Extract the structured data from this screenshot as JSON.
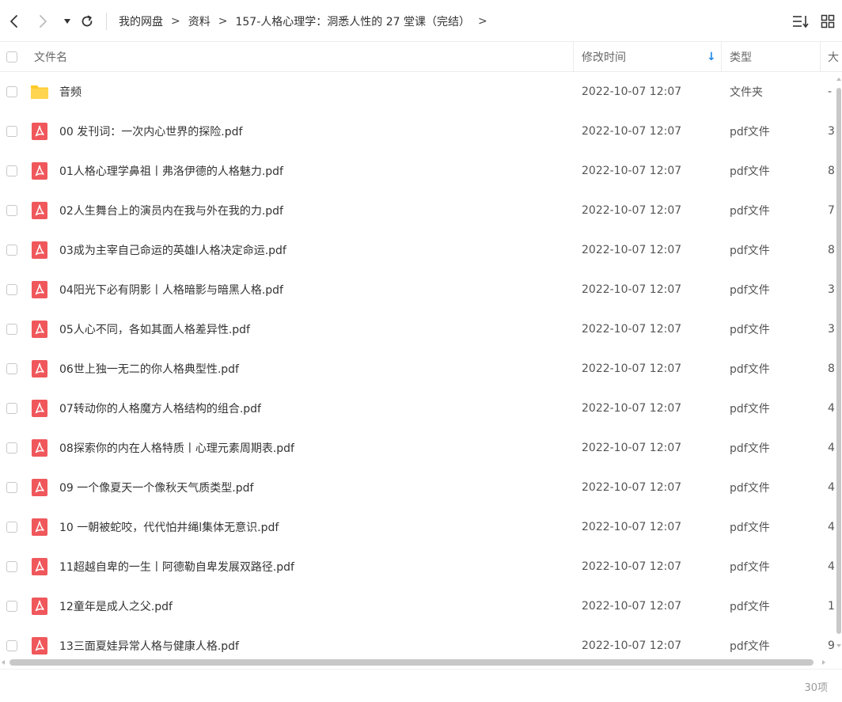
{
  "toolbar": {
    "back_icon": "chevron-left-icon",
    "forward_icon": "chevron-right-icon",
    "history_icon": "caret-down-icon",
    "refresh_icon": "refresh-icon",
    "breadcrumb": [
      "我的网盘",
      "资料",
      "157-人格心理学：洞悉人性的 27 堂课（完结）"
    ],
    "breadcrumb_sep": ">",
    "sort_icon": "sort-list-icon",
    "view_icon": "grid-view-icon"
  },
  "columns": {
    "name": "文件名",
    "modified": "修改时间",
    "sort_indicator": "↓",
    "type": "类型",
    "size": "大"
  },
  "colors": {
    "folder": "#FFCA28",
    "pdf": "#F0575B",
    "sort_arrow": "#1E88E5"
  },
  "files": [
    {
      "name": "音频",
      "date": "2022-10-07 12:07",
      "type": "文件夹",
      "size": "-",
      "icon": "folder"
    },
    {
      "name": "00 发刊词：一次内心世界的探险.pdf",
      "date": "2022-10-07 12:07",
      "type": "pdf文件",
      "size": "3",
      "icon": "pdf"
    },
    {
      "name": "01人格心理学鼻祖丨弗洛伊德的人格魅力.pdf",
      "date": "2022-10-07 12:07",
      "type": "pdf文件",
      "size": "8",
      "icon": "pdf"
    },
    {
      "name": "02人生舞台上的演员内在我与外在我的力.pdf",
      "date": "2022-10-07 12:07",
      "type": "pdf文件",
      "size": "7",
      "icon": "pdf"
    },
    {
      "name": "03成为主宰自己命运的英雄l人格决定命运.pdf",
      "date": "2022-10-07 12:07",
      "type": "pdf文件",
      "size": "8",
      "icon": "pdf"
    },
    {
      "name": "04阳光下必有阴影丨人格暗影与暗黑人格.pdf",
      "date": "2022-10-07 12:07",
      "type": "pdf文件",
      "size": "3",
      "icon": "pdf"
    },
    {
      "name": "05人心不同，各如其面人格差异性.pdf",
      "date": "2022-10-07 12:07",
      "type": "pdf文件",
      "size": "3",
      "icon": "pdf"
    },
    {
      "name": "06世上独一无二的你人格典型性.pdf",
      "date": "2022-10-07 12:07",
      "type": "pdf文件",
      "size": "8",
      "icon": "pdf"
    },
    {
      "name": "07转动你的人格魔方人格结构的组合.pdf",
      "date": "2022-10-07 12:07",
      "type": "pdf文件",
      "size": "4",
      "icon": "pdf"
    },
    {
      "name": "08探索你的内在人格特质丨心理元素周期表.pdf",
      "date": "2022-10-07 12:07",
      "type": "pdf文件",
      "size": "4",
      "icon": "pdf"
    },
    {
      "name": "09 一个像夏天一个像秋天气质类型.pdf",
      "date": "2022-10-07 12:07",
      "type": "pdf文件",
      "size": "4",
      "icon": "pdf"
    },
    {
      "name": "10 一朝被蛇咬，代代怕井绳l集体无意识.pdf",
      "date": "2022-10-07 12:07",
      "type": "pdf文件",
      "size": "4",
      "icon": "pdf"
    },
    {
      "name": "11超越自卑的一生丨阿德勒自卑发展双路径.pdf",
      "date": "2022-10-07 12:07",
      "type": "pdf文件",
      "size": "4",
      "icon": "pdf"
    },
    {
      "name": "12童年是成人之父.pdf",
      "date": "2022-10-07 12:07",
      "type": "pdf文件",
      "size": "1",
      "icon": "pdf"
    },
    {
      "name": "13三面夏娃异常人格与健康人格.pdf",
      "date": "2022-10-07 12:07",
      "type": "pdf文件",
      "size": "9",
      "icon": "pdf"
    }
  ],
  "status": {
    "count": "30项"
  }
}
